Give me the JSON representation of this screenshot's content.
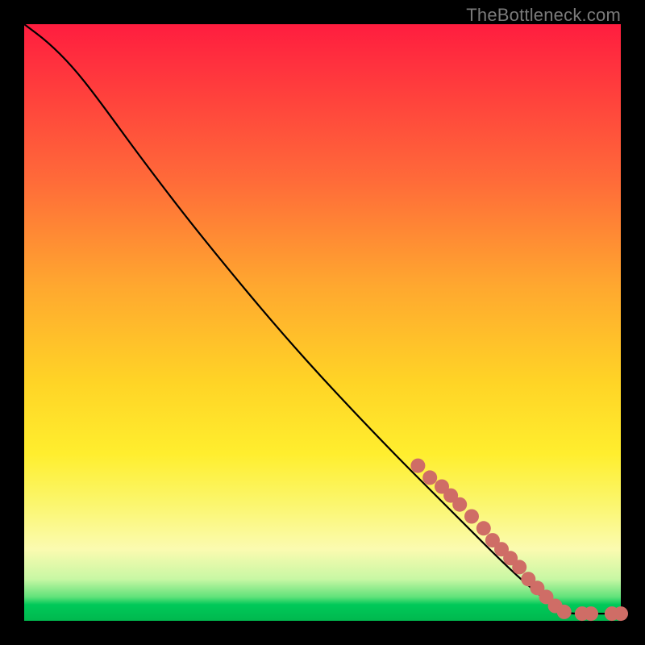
{
  "attribution": "TheBottleneck.com",
  "colors": {
    "dot": "#cf6d66",
    "curve": "#000000",
    "gradient_top": "#ff1d3f",
    "gradient_bottom": "#00b84e",
    "frame": "#000000"
  },
  "chart_data": {
    "type": "line",
    "title": "",
    "xlabel": "",
    "ylabel": "",
    "xlim": [
      0,
      100
    ],
    "ylim": [
      0,
      100
    ],
    "grid": false,
    "legend": false,
    "curve": [
      {
        "x": 0,
        "y": 100
      },
      {
        "x": 4,
        "y": 97
      },
      {
        "x": 8,
        "y": 93
      },
      {
        "x": 12,
        "y": 88
      },
      {
        "x": 20,
        "y": 77
      },
      {
        "x": 30,
        "y": 64
      },
      {
        "x": 45,
        "y": 46
      },
      {
        "x": 60,
        "y": 30
      },
      {
        "x": 72,
        "y": 18
      },
      {
        "x": 82,
        "y": 8
      },
      {
        "x": 88,
        "y": 3
      },
      {
        "x": 91,
        "y": 1.2
      },
      {
        "x": 94,
        "y": 1.2
      },
      {
        "x": 97,
        "y": 1.2
      },
      {
        "x": 100,
        "y": 1.2
      }
    ],
    "points": [
      {
        "x": 66,
        "y": 26
      },
      {
        "x": 68,
        "y": 24
      },
      {
        "x": 70,
        "y": 22.5
      },
      {
        "x": 71.5,
        "y": 21
      },
      {
        "x": 73,
        "y": 19.5
      },
      {
        "x": 75,
        "y": 17.5
      },
      {
        "x": 77,
        "y": 15.5
      },
      {
        "x": 78.5,
        "y": 13.5
      },
      {
        "x": 80,
        "y": 12
      },
      {
        "x": 81.5,
        "y": 10.5
      },
      {
        "x": 83,
        "y": 9
      },
      {
        "x": 84.5,
        "y": 7
      },
      {
        "x": 86,
        "y": 5.5
      },
      {
        "x": 87.5,
        "y": 4
      },
      {
        "x": 89,
        "y": 2.5
      },
      {
        "x": 90.5,
        "y": 1.5
      },
      {
        "x": 93.5,
        "y": 1.2
      },
      {
        "x": 95,
        "y": 1.2
      },
      {
        "x": 98.5,
        "y": 1.2
      },
      {
        "x": 100,
        "y": 1.2
      }
    ],
    "dot_radius_px": 9
  }
}
